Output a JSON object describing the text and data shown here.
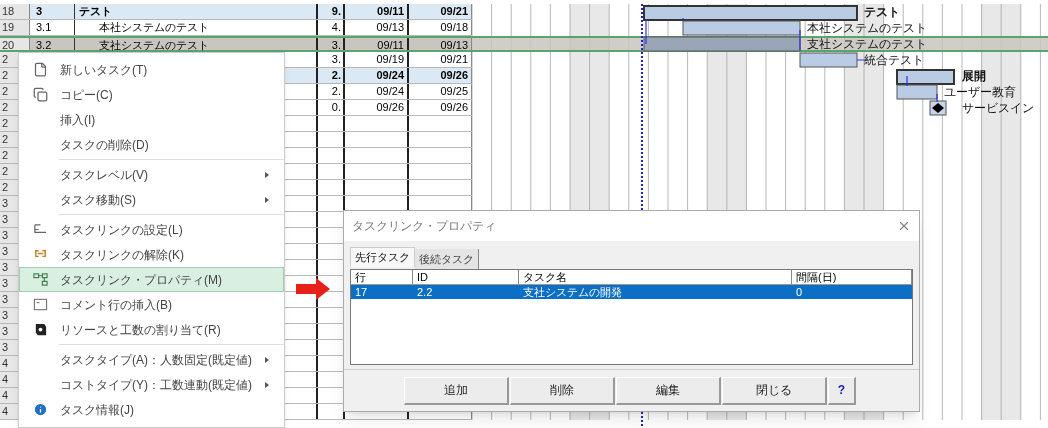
{
  "sheet": {
    "rows": [
      {
        "number": "18",
        "id": "3",
        "name": "テスト",
        "duration": "9.",
        "start": "09/11",
        "end": "09/21",
        "kind": "summary",
        "selected": false
      },
      {
        "number": "19",
        "id": "3.1",
        "name": "本社システムのテスト",
        "duration": "4.",
        "start": "09/13",
        "end": "09/18",
        "kind": "task",
        "selected": false
      },
      {
        "number": "20",
        "id": "3.2",
        "name": "支社システムのテスト",
        "duration": "3.",
        "start": "09/11",
        "end": "09/13",
        "kind": "task",
        "selected": true
      },
      {
        "number": "2",
        "duration": "3.",
        "start": "09/19",
        "end": "09/21",
        "kind": "task",
        "selected": false
      },
      {
        "number": "2",
        "duration": "2.",
        "start": "09/24",
        "end": "09/26",
        "kind": "summary",
        "selected": false
      },
      {
        "number": "2",
        "duration": "2.",
        "start": "09/24",
        "end": "09/25",
        "kind": "task",
        "selected": false
      },
      {
        "number": "2",
        "duration": "0.",
        "start": "09/26",
        "end": "09/26",
        "kind": "task",
        "selected": false
      },
      {
        "number": "2",
        "kind": "empty",
        "selected": false
      },
      {
        "number": "2",
        "kind": "empty",
        "selected": false
      },
      {
        "number": "2",
        "kind": "empty",
        "selected": false
      },
      {
        "number": "2",
        "kind": "empty",
        "selected": false
      },
      {
        "number": "2",
        "kind": "empty",
        "selected": false
      },
      {
        "number": "3",
        "kind": "empty",
        "selected": false
      },
      {
        "number": "3",
        "kind": "empty",
        "selected": false
      },
      {
        "number": "3",
        "kind": "empty",
        "selected": false
      },
      {
        "number": "3",
        "kind": "empty",
        "selected": false
      },
      {
        "number": "3",
        "kind": "empty",
        "selected": false
      },
      {
        "number": "3",
        "kind": "empty",
        "selected": false
      },
      {
        "number": "3",
        "kind": "empty",
        "selected": false
      },
      {
        "number": "3",
        "kind": "empty",
        "selected": false
      },
      {
        "number": "3",
        "kind": "empty",
        "selected": false
      },
      {
        "number": "3",
        "kind": "empty",
        "selected": false
      },
      {
        "number": "4",
        "kind": "empty",
        "selected": false
      },
      {
        "number": "4",
        "kind": "empty",
        "selected": false
      },
      {
        "number": "4",
        "kind": "empty",
        "selected": false
      },
      {
        "number": "4",
        "kind": "empty",
        "selected": false
      }
    ]
  },
  "gantt": {
    "tasks": [
      {
        "label": "テスト",
        "kind": "summary"
      },
      {
        "label": "本社システムのテスト",
        "kind": "task"
      },
      {
        "label": "支社システムのテスト",
        "kind": "task"
      },
      {
        "label": "統合テスト",
        "kind": "task"
      },
      {
        "label": "展開",
        "kind": "summary"
      },
      {
        "label": "ユーザー教育",
        "kind": "task"
      },
      {
        "label": "サービスイン",
        "kind": "milestone"
      }
    ]
  },
  "context_menu": {
    "groups": [
      [
        {
          "label": "新しいタスク(T)",
          "submenu": false,
          "selected": false
        },
        {
          "label": "コピー(C)",
          "submenu": false,
          "selected": false
        },
        {
          "label": "挿入(I)",
          "submenu": false,
          "selected": false
        },
        {
          "label": "タスクの削除(D)",
          "submenu": false,
          "selected": false
        }
      ],
      [
        {
          "label": "タスクレベル(V)",
          "submenu": true,
          "selected": false
        },
        {
          "label": "タスク移動(S)",
          "submenu": true,
          "selected": false
        }
      ],
      [
        {
          "label": "タスクリンクの設定(L)",
          "submenu": false,
          "selected": false
        },
        {
          "label": "タスクリンクの解除(K)",
          "submenu": false,
          "selected": false
        },
        {
          "label": "タスクリンク・プロパティ(M)",
          "submenu": false,
          "selected": true
        },
        {
          "label": "コメント行の挿入(B)",
          "submenu": false,
          "selected": false
        },
        {
          "label": "リソースと工数の割り当て(R)",
          "submenu": false,
          "selected": false
        }
      ],
      [
        {
          "label": "タスクタイプ(A)：人数固定(既定値)",
          "submenu": true,
          "selected": false
        },
        {
          "label": "コストタイプ(Y)：工数連動(既定値)",
          "submenu": true,
          "selected": false
        },
        {
          "label": "タスク情報(J)",
          "submenu": false,
          "selected": false
        }
      ]
    ]
  },
  "dialog": {
    "title": "タスクリンク・プロパティ",
    "tabs": [
      {
        "label": "先行タスク",
        "selected": true
      },
      {
        "label": "後続タスク",
        "selected": false
      }
    ],
    "columns": [
      "行",
      "ID",
      "タスク名",
      "間隔(日)"
    ],
    "rows": [
      {
        "cells": [
          "17",
          "2.2",
          "支社システムの開発",
          "0"
        ],
        "selected": true
      }
    ],
    "buttons": [
      "追加",
      "削除",
      "編集",
      "閉じる",
      "?"
    ]
  }
}
